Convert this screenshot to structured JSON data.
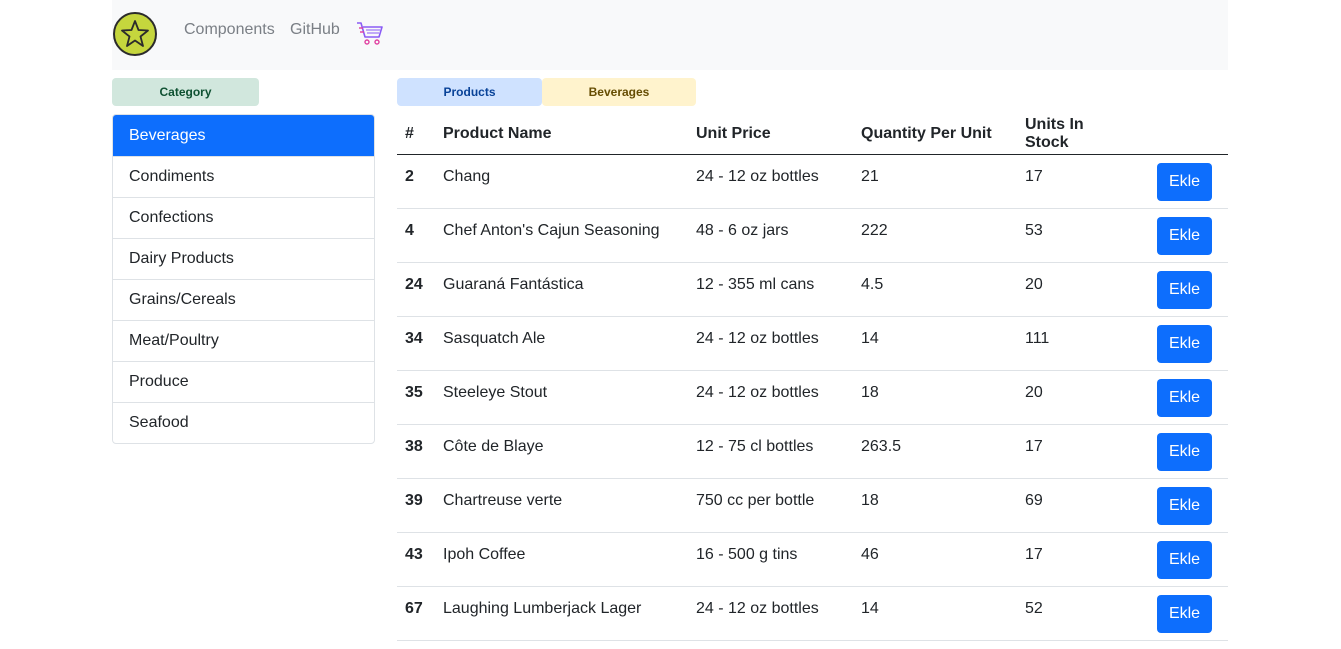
{
  "nav": {
    "links": [
      "Components",
      "GitHub"
    ]
  },
  "badges": {
    "category": "Category",
    "products": "Products",
    "current_category": "Beverages"
  },
  "categories": [
    {
      "label": "Beverages",
      "active": true
    },
    {
      "label": "Condiments"
    },
    {
      "label": "Confections"
    },
    {
      "label": "Dairy Products"
    },
    {
      "label": "Grains/Cereals"
    },
    {
      "label": "Meat/Poultry"
    },
    {
      "label": "Produce"
    },
    {
      "label": "Seafood"
    }
  ],
  "table": {
    "headers": [
      "#",
      "Product Name",
      "Unit Price",
      "Quantity Per Unit",
      "Units In Stock"
    ],
    "button_label": "Ekle",
    "rows": [
      [
        "2",
        "Chang",
        "24 - 12 oz bottles",
        "21",
        "17"
      ],
      [
        "4",
        "Chef Anton's Cajun Seasoning",
        "48 - 6 oz jars",
        "222",
        "53"
      ],
      [
        "24",
        "Guaraná Fantástica",
        "12 - 355 ml cans",
        "4.5",
        "20"
      ],
      [
        "34",
        "Sasquatch Ale",
        "24 - 12 oz bottles",
        "14",
        "111"
      ],
      [
        "35",
        "Steeleye Stout",
        "24 - 12 oz bottles",
        "18",
        "20"
      ],
      [
        "38",
        "Côte de Blaye",
        "12 - 75 cl bottles",
        "263.5",
        "17"
      ],
      [
        "39",
        "Chartreuse verte",
        "750 cc per bottle",
        "18",
        "69"
      ],
      [
        "43",
        "Ipoh Coffee",
        "16 - 500 g tins",
        "46",
        "17"
      ],
      [
        "67",
        "Laughing Lumberjack Lager",
        "24 - 12 oz bottles",
        "14",
        "52"
      ]
    ]
  },
  "icons": {
    "logo": "star-icon",
    "cart": "cart-icon"
  },
  "colors": {
    "primary": "#0d6efd",
    "logo_fill": "#c5d63d"
  }
}
